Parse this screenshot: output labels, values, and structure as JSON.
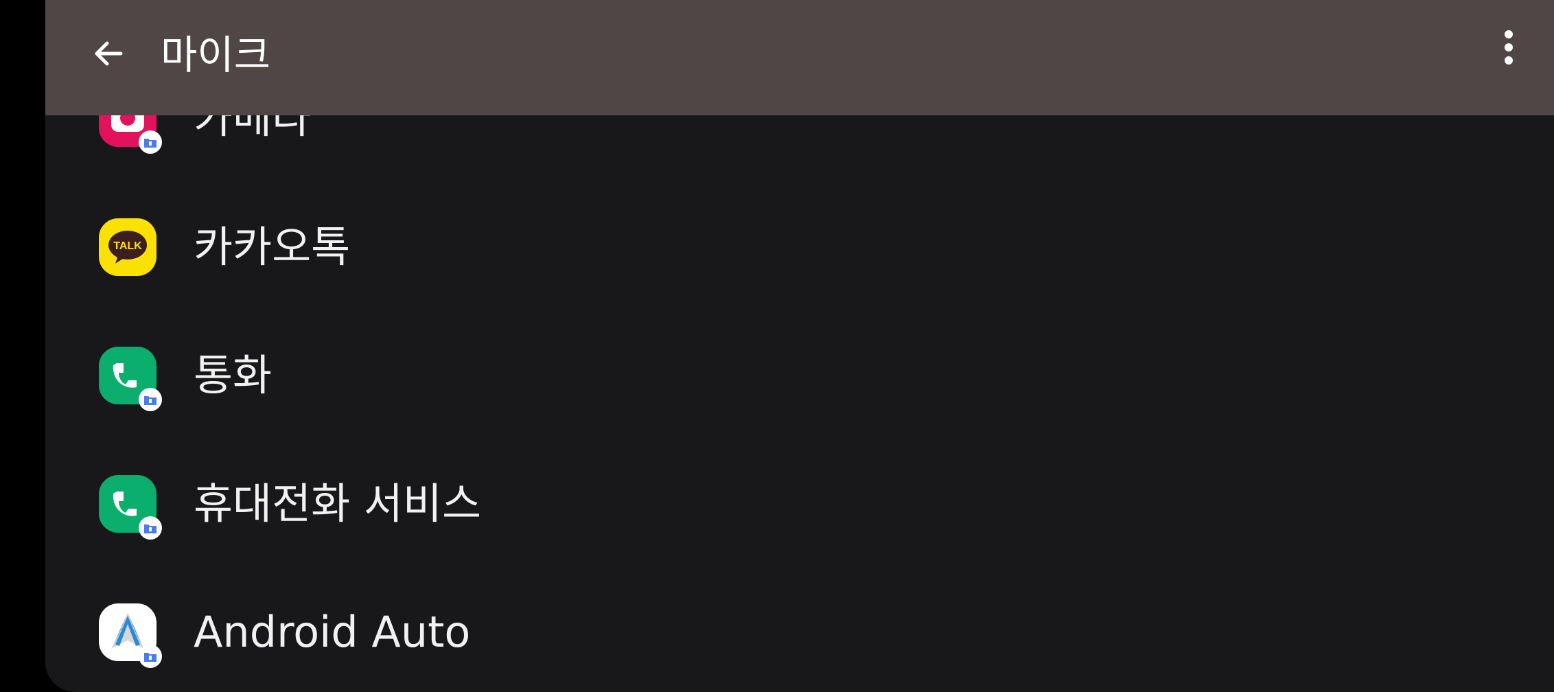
{
  "header": {
    "title": "마이크",
    "back_icon": "arrow-back-icon",
    "more_icon": "more-vert-icon"
  },
  "apps": [
    {
      "label": "카메라",
      "icon": "camera-app-icon",
      "icon_color": "#e2135c",
      "badge": "work-profile-badge-icon"
    },
    {
      "label": "카카오톡",
      "icon": "kakaotalk-app-icon",
      "icon_color": "#fae100",
      "icon_text": "TALK"
    },
    {
      "label": "통화",
      "icon": "phone-app-icon",
      "icon_color": "#0bae6c",
      "badge": "work-profile-badge-icon"
    },
    {
      "label": "휴대전화 서비스",
      "icon": "phone-services-app-icon",
      "icon_color": "#0bae6c",
      "badge": "work-profile-badge-icon"
    },
    {
      "label": "Android Auto",
      "icon": "android-auto-app-icon",
      "icon_color": "#ffffff",
      "badge": "work-profile-badge-icon"
    }
  ],
  "colors": {
    "app_bar": "#4f4645",
    "background": "#18181a",
    "text": "#f1f1f1",
    "badge_blue": "#4b7bec"
  }
}
